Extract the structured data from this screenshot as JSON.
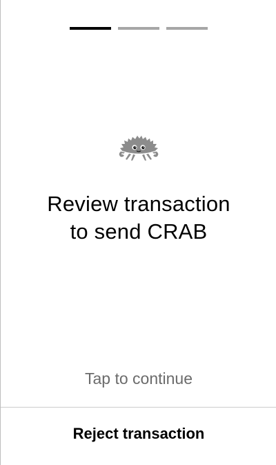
{
  "progress": {
    "total_steps": 3,
    "current_step": 1,
    "active_color": "#000000",
    "inactive_color": "#a6a6a6"
  },
  "crab": {
    "icon": "ferris-crab-icon",
    "color": "#8c8c8c"
  },
  "title": {
    "line1": "Review transaction",
    "line2": "to send CRAB"
  },
  "hint": "Tap to continue",
  "reject_button": {
    "label": "Reject transaction"
  }
}
